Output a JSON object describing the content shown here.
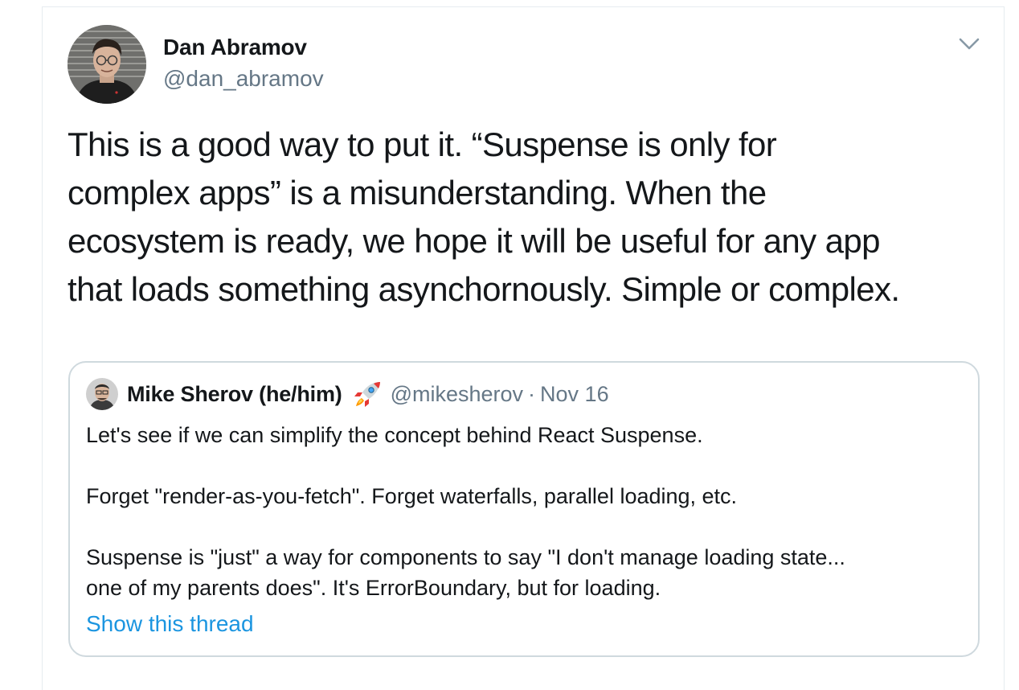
{
  "tweet": {
    "author": {
      "name": "Dan Abramov",
      "handle": "@dan_abramov"
    },
    "text_lines": [
      "This is a good way to put it. “Suspense is only for",
      "complex apps” is a misunderstanding. When the",
      "ecosystem is ready, we hope it will be useful for any app",
      "that loads something asynchornously. Simple or complex."
    ]
  },
  "quoted_tweet": {
    "author": {
      "name": "Mike Sherov (he/him)",
      "emoji": "rocket-icon",
      "handle": "@mikesherov"
    },
    "separator": "·",
    "date": "Nov 16",
    "paragraph_1": "Let's see if we can simplify the concept behind React Suspense.",
    "paragraph_2": "Forget \"render-as-you-fetch\". Forget waterfalls, parallel loading, etc.",
    "paragraph_3_lines": [
      "Suspense is \"just\" a way for components to say \"I don't manage loading state...",
      "one of my parents does\". It's ErrorBoundary, but for loading."
    ],
    "show_thread": "Show this thread"
  },
  "colors": {
    "text": "#14171a",
    "secondary": "#657786",
    "link": "#1b95e0",
    "border": "#cfd9de"
  }
}
